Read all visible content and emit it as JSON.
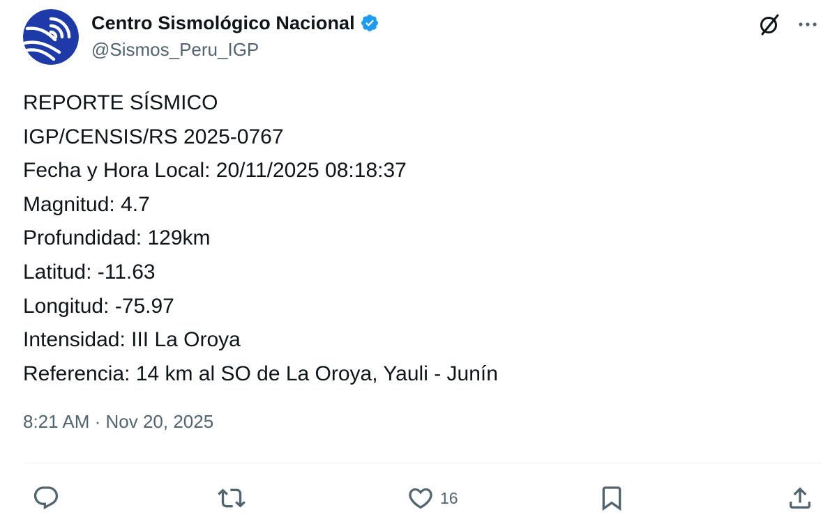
{
  "account": {
    "display_name": "Centro Sismológico Nacional",
    "handle": "@Sismos_Peru_IGP",
    "verified": true,
    "avatar_icon": "igp-logo",
    "avatar_colors": [
      "#1d3aa8",
      "#ffffff"
    ]
  },
  "top_actions": {
    "grok_icon": "grok-icon",
    "more_icon": "more-icon"
  },
  "post": {
    "lines": [
      "REPORTE SÍSMICO",
      "IGP/CENSIS/RS 2025-0767",
      "Fecha y Hora Local: 20/11/2025 08:18:37",
      "Magnitud: 4.7",
      "Profundidad: 129km",
      "Latitud: -11.63",
      "Longitud: -75.97",
      "Intensidad: III La Oroya",
      "Referencia: 14 km al SO de La Oroya, Yauli - Junín"
    ],
    "timestamp": "8:21 AM · Nov 20, 2025"
  },
  "actions": {
    "reply_icon": "reply-icon",
    "repost_icon": "repost-icon",
    "like_icon": "heart-icon",
    "like_count": "16",
    "bookmark_icon": "bookmark-icon",
    "share_icon": "share-icon"
  },
  "colors": {
    "text": "#0f1419",
    "secondary": "#536471",
    "verified_badge": "#1d9bf0",
    "divider": "#eff3f4"
  }
}
